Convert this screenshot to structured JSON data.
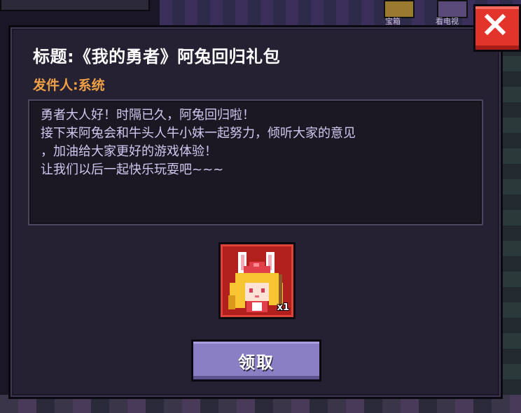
{
  "background": {
    "icon_labels": [
      "宝箱",
      "看电视"
    ]
  },
  "mail": {
    "title": "标题:《我的勇者》阿兔回归礼包",
    "sender": "发件人:系统",
    "body": "勇者大人好！时隔已久，阿兔回归啦！\n接下来阿兔会和牛头人牛小妹一起努力，倾听大家的意见\n，加油给大家更好的游戏体验！\n让我们以后一起快乐玩耍吧~~~"
  },
  "reward": {
    "icon": "bunny-hero-avatar-icon",
    "count": "x1"
  },
  "buttons": {
    "claim_label": "领取",
    "close_icon": "close-x-icon"
  },
  "colors": {
    "panel_bg": "#252032",
    "title": "#ffffff",
    "sender": "#f0a146",
    "body_text": "#d2c8ef",
    "claim_button": "#8a7fc4",
    "close_button": "#e3342c",
    "reward_frame": "#b1201c"
  }
}
